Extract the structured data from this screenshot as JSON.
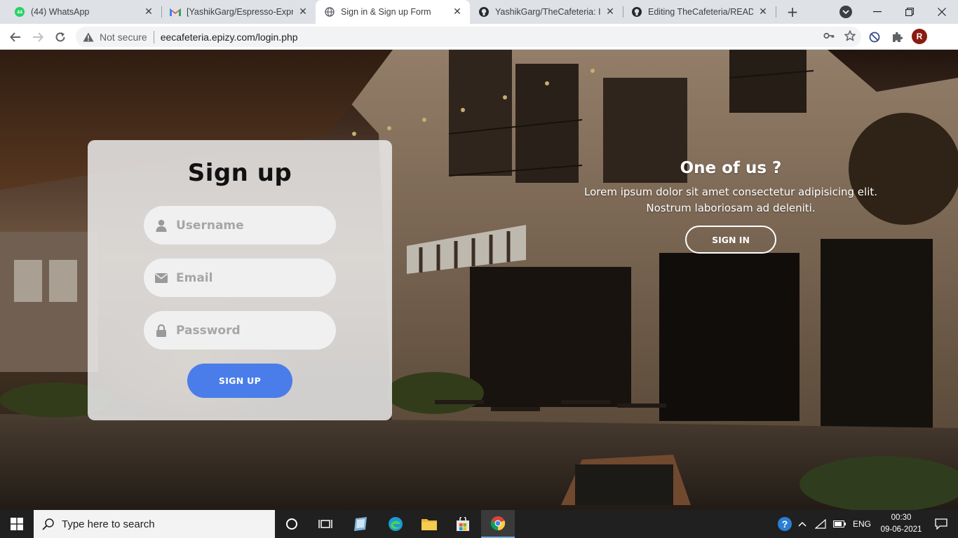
{
  "browser": {
    "tabs": [
      {
        "title": "(44) WhatsApp",
        "badge": "44",
        "active": false
      },
      {
        "title": "[YashikGarg/Espresso-Express",
        "active": false
      },
      {
        "title": "Sign in & Sign up Form",
        "active": true
      },
      {
        "title": "YashikGarg/TheCafeteria: I ma",
        "active": false
      },
      {
        "title": "Editing TheCafeteria/READM",
        "active": false
      }
    ],
    "address": {
      "security_label": "Not secure",
      "url": "eecafeteria.epizy.com/login.php"
    },
    "profile_initial": "R"
  },
  "signup": {
    "title": "Sign up",
    "username_placeholder": "Username",
    "email_placeholder": "Email",
    "password_placeholder": "Password",
    "submit_label": "SIGN UP"
  },
  "panel": {
    "title": "One of us ?",
    "text_line1": "Lorem ipsum dolor sit amet consectetur adipisicing elit.",
    "text_line2": "Nostrum laboriosam ad deleniti.",
    "signin_label": "SIGN IN"
  },
  "taskbar": {
    "search_placeholder": "Type here to search",
    "language": "ENG",
    "time": "00:30",
    "date": "09-06-2021"
  },
  "colors": {
    "primary_button": "#4a7de9",
    "card_background": "#ececec",
    "tabstrip": "#dee1e6",
    "taskbar": "#202020"
  }
}
